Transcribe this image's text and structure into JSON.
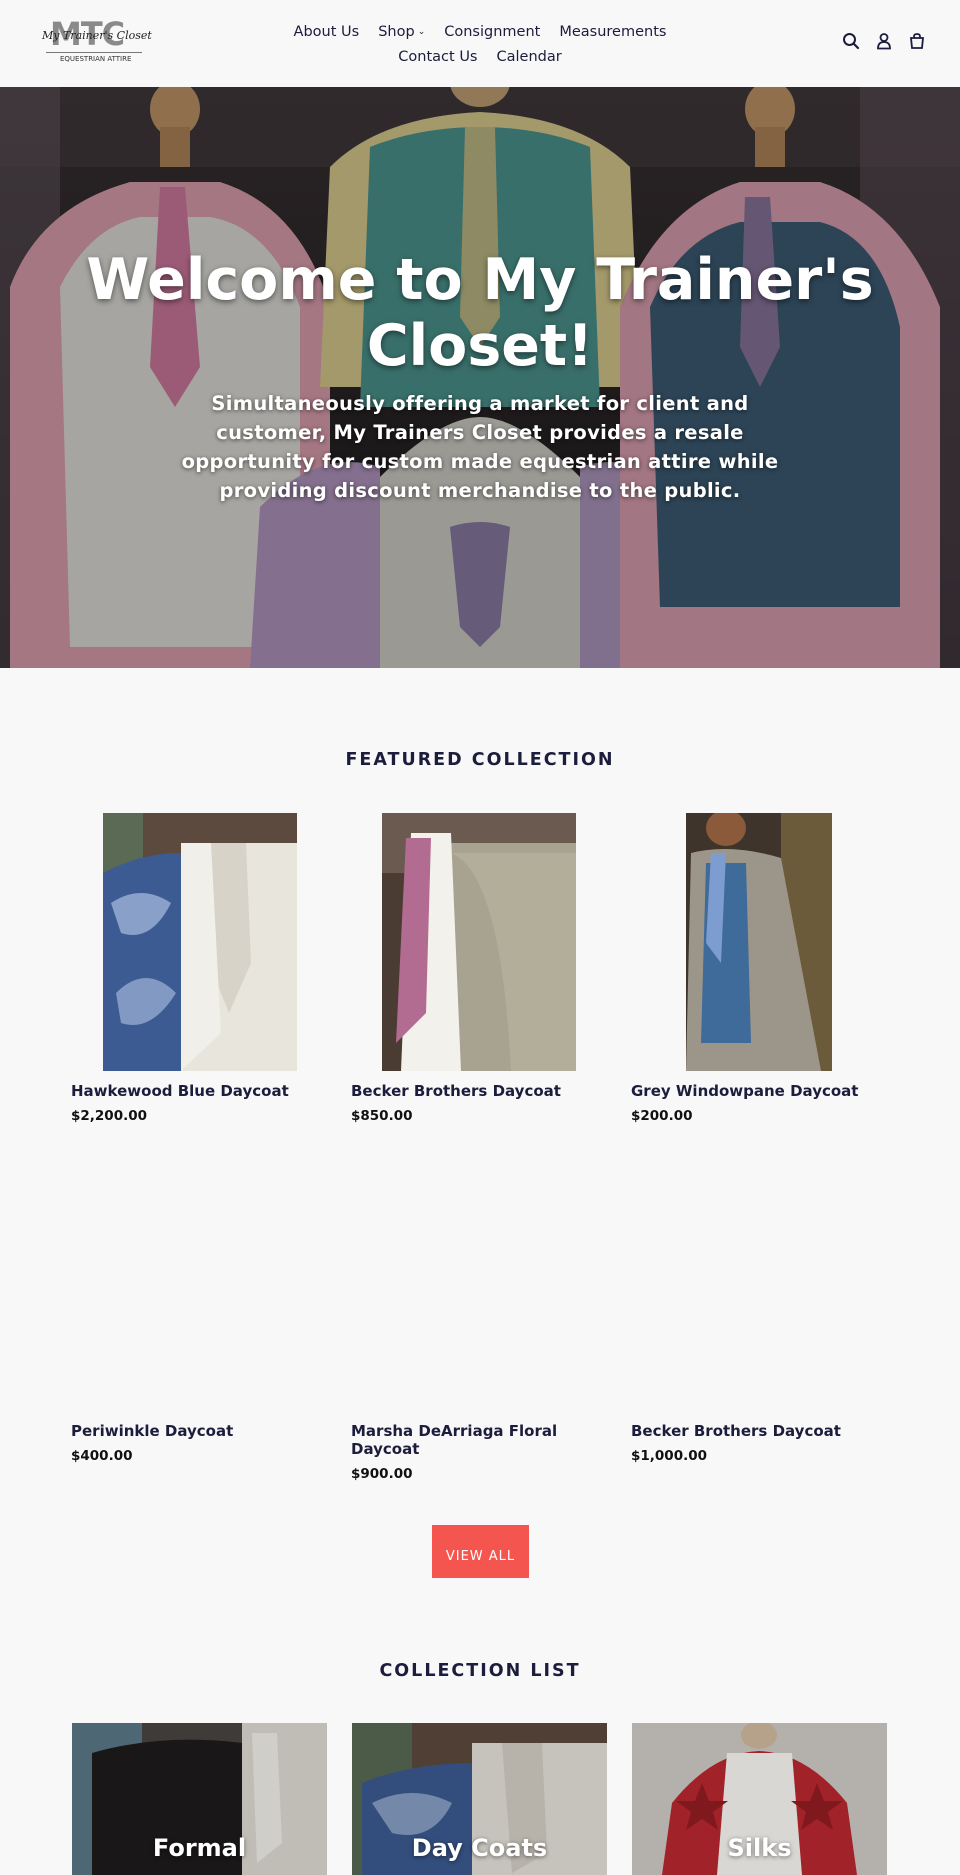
{
  "brand": {
    "logo_mark": "MTC",
    "logo_script": "My Trainer's Closet",
    "logo_sub": "EQUESTRIAN ATTIRE"
  },
  "nav": {
    "row1": [
      "About Us",
      "Shop",
      "Consignment",
      "Measurements"
    ],
    "row2": [
      "Contact Us",
      "Calendar"
    ]
  },
  "header_icons": [
    "search-icon",
    "account-icon",
    "cart-icon"
  ],
  "hero": {
    "title": "Welcome to My Trainer's Closet!",
    "subtitle": "Simultaneously offering a market for client and customer, My Trainers Closet provides a resale opportunity for custom made equestrian attire while providing discount merchandise to the public."
  },
  "featured": {
    "title": "FEATURED COLLECTION",
    "products": [
      {
        "name": "Hawkewood Blue Daycoat",
        "price": "$2,200.00"
      },
      {
        "name": "Becker Brothers Daycoat",
        "price": "$850.00"
      },
      {
        "name": "Grey Windowpane Daycoat",
        "price": "$200.00"
      },
      {
        "name": "Periwinkle Daycoat",
        "price": "$400.00"
      },
      {
        "name": "Marsha DeArriaga Floral Daycoat",
        "price": "$900.00"
      },
      {
        "name": "Becker Brothers Daycoat",
        "price": "$1,000.00"
      }
    ],
    "view_all": "VIEW ALL"
  },
  "collections": {
    "title": "COLLECTION LIST",
    "items": [
      "Formal",
      "Day Coats",
      "Silks"
    ]
  },
  "colors": {
    "text": "#1c1d3c",
    "background": "#f8f8f8",
    "button": "#f5554f"
  }
}
